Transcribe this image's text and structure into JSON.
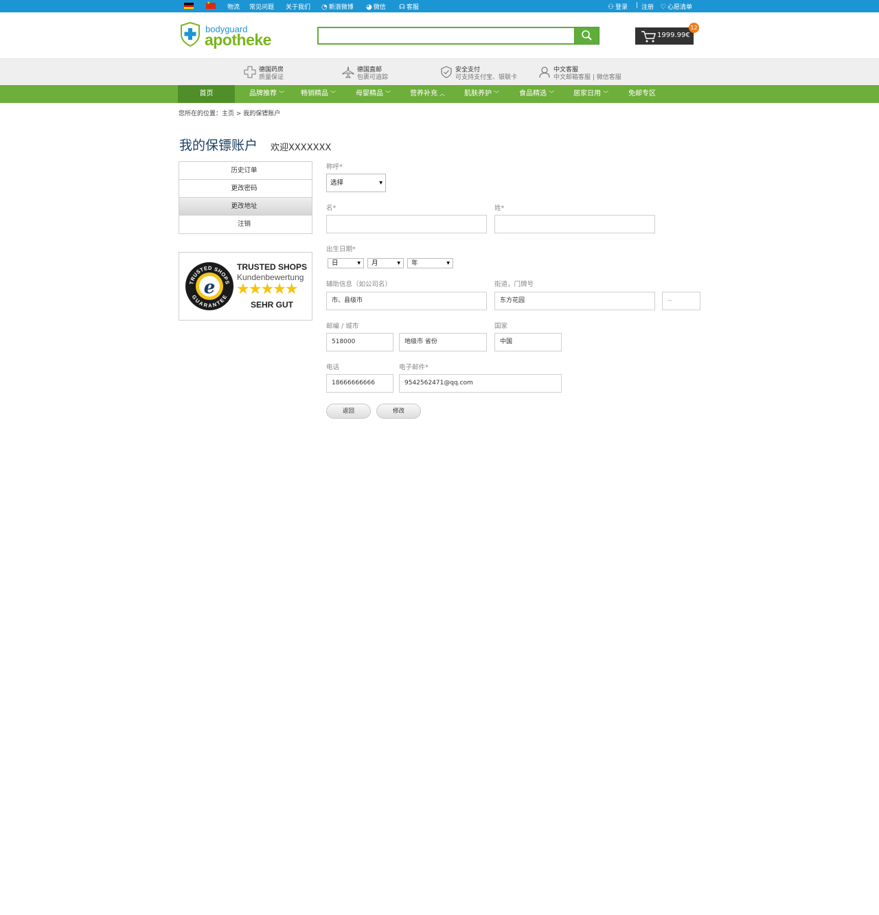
{
  "topbar": {
    "links": [
      "物流",
      "常见问题",
      "关于我们"
    ],
    "weibo": "新浪微博",
    "wechat": "微信",
    "service": "客服",
    "login": "登录",
    "separator": "|",
    "register": "注册",
    "wishlist": "心愿清单"
  },
  "header": {
    "logo_small": "bodyguard",
    "logo_big": "apotheke",
    "search_value": "",
    "cart_total": "1999.99€",
    "cart_count": "12"
  },
  "features": [
    {
      "title": "德国药房",
      "sub": "质量保证",
      "icon": "plus-icon"
    },
    {
      "title": "德国直邮",
      "sub": "包裹可追踪",
      "icon": "plane-icon"
    },
    {
      "title": "安全支付",
      "sub": "可支持支付宝、银联卡",
      "icon": "shield-check-icon"
    },
    {
      "title": "中文客服",
      "sub": "中文邮箱客服 | 微信客服",
      "icon": "user-icon"
    }
  ],
  "nav": {
    "items": [
      "首页",
      "品牌推荐",
      "畅销精品",
      "母婴精品",
      "营养补充",
      "肌肤养护",
      "食品精选",
      "居家日用",
      "免邮专区"
    ]
  },
  "breadcrumb": "您所在的位置：主页 > 我的保镖账户",
  "page": {
    "title": "我的保镖账户",
    "welcome": "欢迎XXXXXXX"
  },
  "sidebar": {
    "items": [
      "历史订单",
      "更改密码",
      "更改地址",
      "注销"
    ],
    "active": "更改地址"
  },
  "trusted": {
    "line1": "TRUSTED SHOPS",
    "line2": "Kundenbewertung",
    "line3": "SEHR GUT",
    "rating": "5/5",
    "seal_top": "TRUSTED SHOPS",
    "seal_bottom": "GUARANTEE",
    "seal_letter": "e"
  },
  "form": {
    "salutation_label": "称呼*",
    "salutation_value": "选择",
    "firstname_label": "名*",
    "firstname_value": "",
    "lastname_label": "姓*",
    "lastname_value": "",
    "birth_label": "出生日期*",
    "birth_day": "日",
    "birth_month": "月",
    "birth_year": "年",
    "extra_label": "辅助信息（如公司名）",
    "extra_value": "市、县级市",
    "street_label": "街道，门牌号",
    "street_value": "东方花园",
    "house_value": "--",
    "zip_label": "邮编 / 城市",
    "zip_value": "518000",
    "city_value": "地级市 省份",
    "country_label": "国家",
    "country_value": "中国",
    "phone_label": "电话",
    "phone_value": "18666666666",
    "email_label": "电子邮件*",
    "email_value": "9542562471@qq.com",
    "back_button": "返回",
    "submit_button": "修改"
  }
}
